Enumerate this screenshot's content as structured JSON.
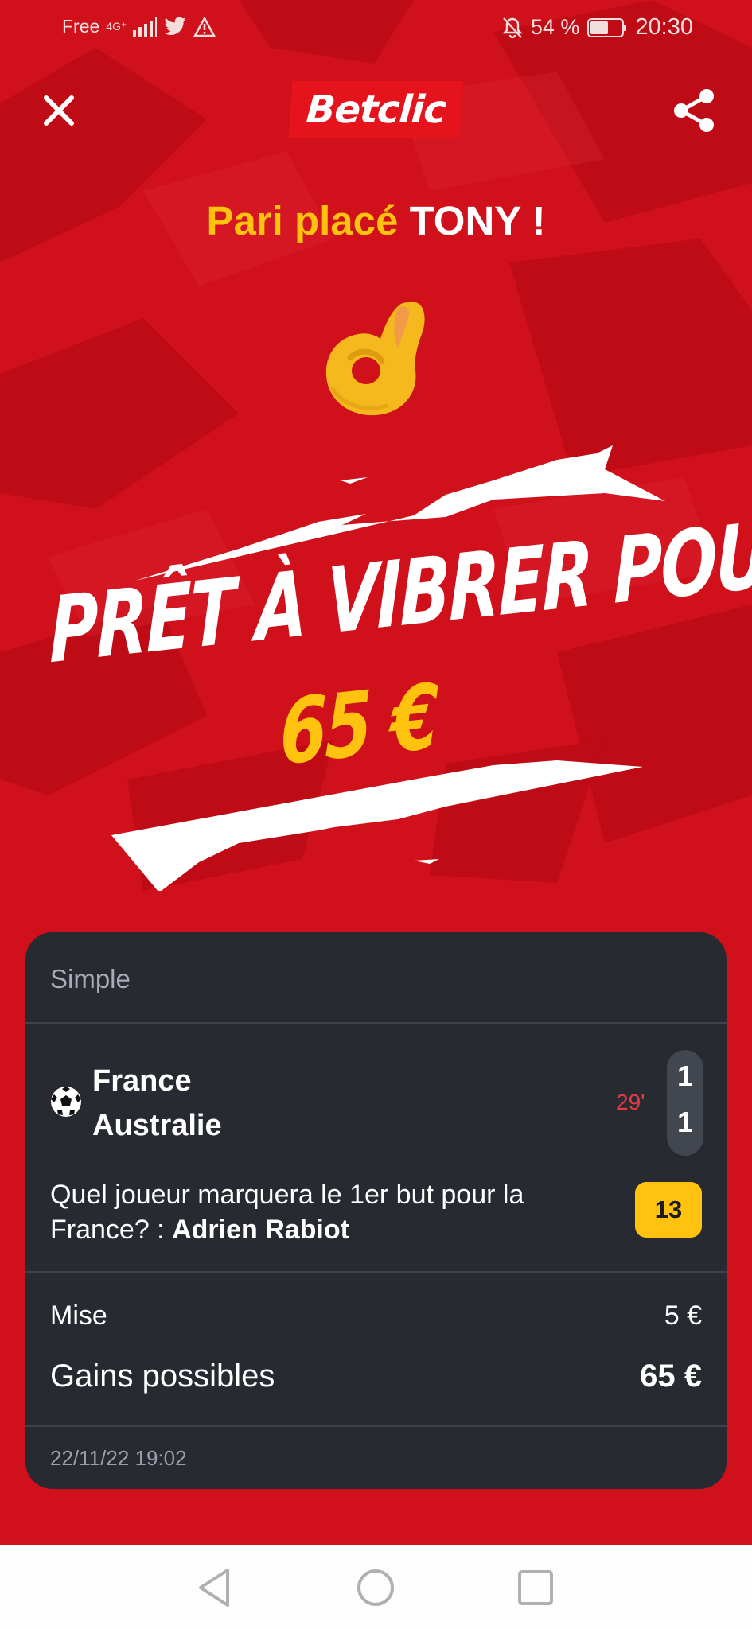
{
  "status_bar": {
    "carrier": "Free",
    "network": "4G⁺",
    "battery_percent": "54 %",
    "time": "20:30",
    "icons": [
      "signal-icon",
      "twitter-icon",
      "warning-icon",
      "bell-off-icon",
      "battery-icon"
    ]
  },
  "header": {
    "logo_text": "Betclic",
    "close_icon": "close-icon",
    "share_icon": "share-icon"
  },
  "headline": {
    "prefix": "Pari placé",
    "name": "TONY !"
  },
  "hero": {
    "line1": "PRÊT À VIBRER POUR",
    "amount": "65 €"
  },
  "bet": {
    "type": "Simple",
    "sport_icon": "soccer-ball-icon",
    "home_team": "France",
    "away_team": "Australie",
    "match_minute": "29'",
    "home_score": "1",
    "away_score": "1",
    "question": "Quel joueur marquera le 1er but pour la France? :",
    "selection": "Adrien Rabiot",
    "odds": "13",
    "stake_label": "Mise",
    "stake_value": "5 €",
    "gain_label": "Gains possibles",
    "gain_value": "65 €",
    "placed_at": "22/11/22 19:02"
  },
  "colors": {
    "brand_red": "#d0101b",
    "accent_yellow": "#ffc20e",
    "card_bg": "#272a31",
    "live_red": "#e63946"
  },
  "nav_bar": {
    "icons": [
      "back-icon",
      "home-icon",
      "recent-apps-icon"
    ]
  }
}
